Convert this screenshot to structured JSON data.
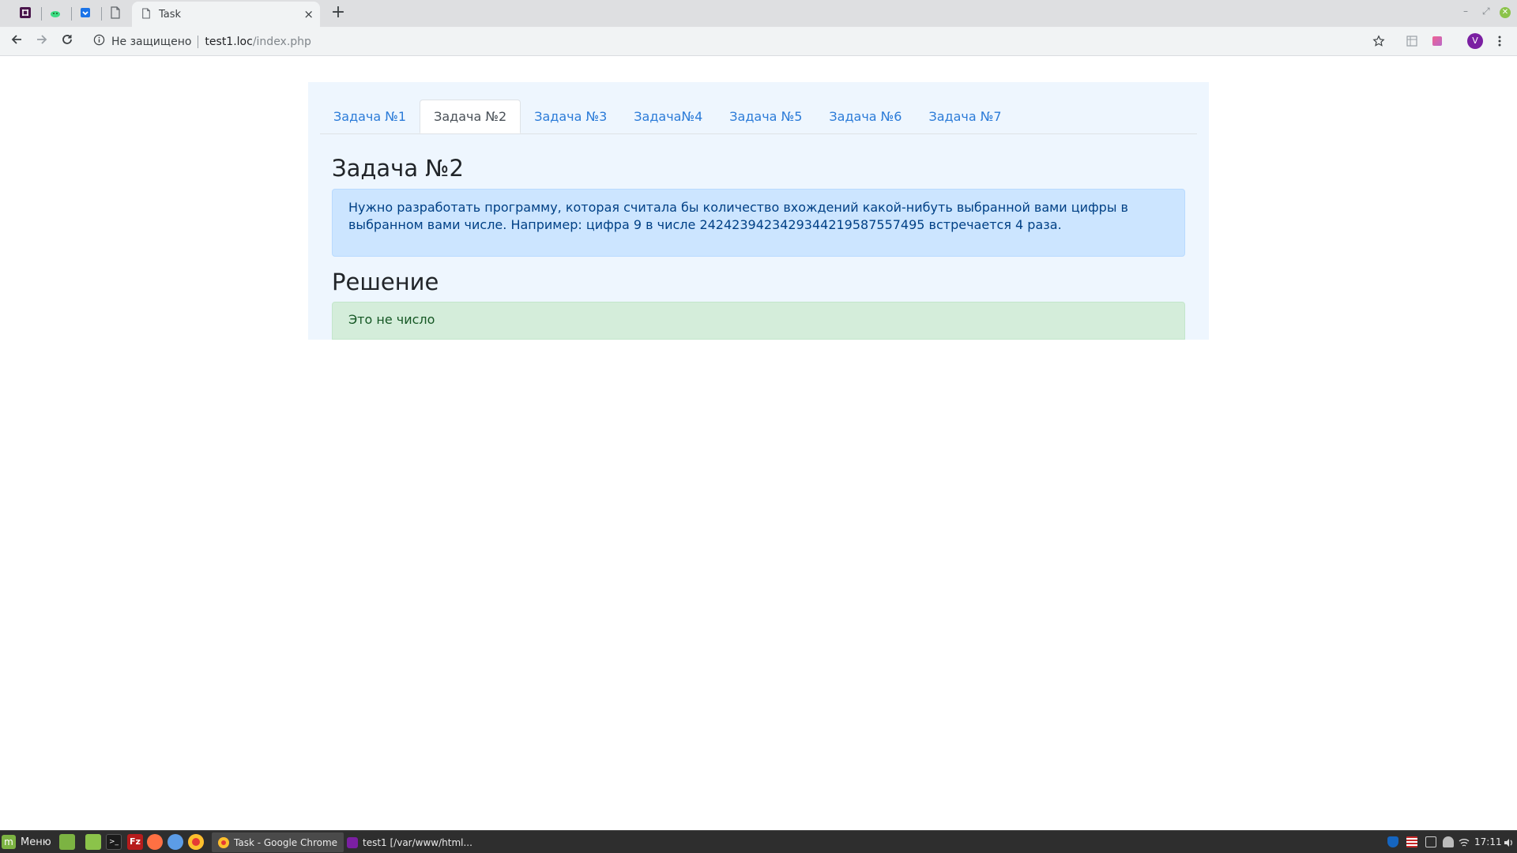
{
  "browser": {
    "pinned_tabs": [
      {
        "icon": "slack-icon",
        "color": "#4a154b"
      },
      {
        "icon": "android-studio-icon",
        "color": "#3ddc84"
      },
      {
        "icon": "trello-icon",
        "color": "#1a73e8"
      },
      {
        "icon": "page-icon",
        "color": "#5f6368"
      }
    ],
    "active_tab": {
      "title": "Task",
      "icon": "page-icon"
    },
    "new_tab_label": "+",
    "close_tab_label": "×",
    "omnibox": {
      "security_label": "Не защищено",
      "host": "test1.loc",
      "path": "/index.php"
    },
    "avatar_letter": "V",
    "avatar_color": "#7b1fa2"
  },
  "page": {
    "nav_tabs": [
      {
        "label": "Задача №1",
        "active": false
      },
      {
        "label": "Задача №2",
        "active": true
      },
      {
        "label": "Задача №3",
        "active": false
      },
      {
        "label": "Задача№4",
        "active": false
      },
      {
        "label": "Задача №5",
        "active": false
      },
      {
        "label": "Задача №6",
        "active": false
      },
      {
        "label": "Задача №7",
        "active": false
      }
    ],
    "task_title": "Задача №2",
    "task_description": "Нужно разработать программу, которая считала бы количество вхождений какой-нибуть выбранной вами цифры в выбранном вами числе. Например: цифра 9 в числе 24242394234293442195875574​95 встречается 4 раза.",
    "solution_title": "Решение",
    "solution_result": "Это не число",
    "colors": {
      "link": "#2b7bd8",
      "info_bg": "#cce5ff",
      "success_bg": "#d4edda",
      "container_bg": "#eef6fe"
    }
  },
  "taskbar": {
    "menu_label": "Меню",
    "windows": [
      {
        "label": "Task - Google Chrome",
        "active": true,
        "icon": "chrome-icon"
      },
      {
        "label": "test1 [/var/www/html...",
        "active": false,
        "icon": "phpstorm-icon"
      }
    ],
    "clock": "17:11"
  }
}
